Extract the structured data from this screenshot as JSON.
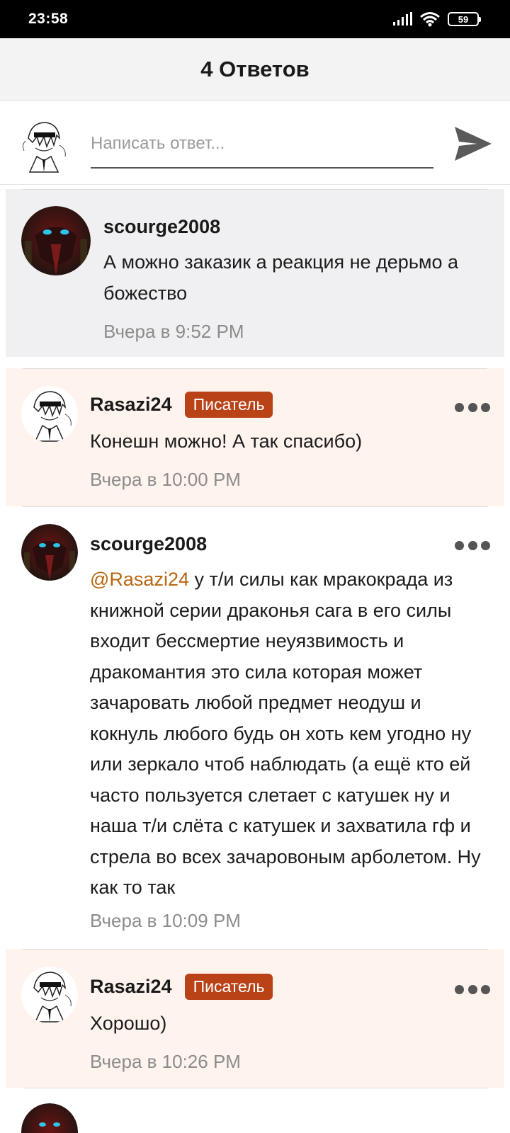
{
  "status_bar": {
    "time": "23:58",
    "battery": "59"
  },
  "header": {
    "title": "4 Ответов"
  },
  "composer": {
    "placeholder": "Написать ответ..."
  },
  "comments": [
    {
      "username": "scourge2008",
      "text": "А можно заказик а реакция не дерьмо а божество",
      "timestamp": "Вчера в 9:52 PM"
    },
    {
      "username": "Rasazi24",
      "badge": "Писатель",
      "text": "Конешн можно! А так спасибо)",
      "timestamp": "Вчера в 10:00 PM"
    },
    {
      "username": "scourge2008",
      "mention": "@Rasazi24",
      "text": " у т/и силы как мракокрада из книжной серии драконья сага в его силы входит бессмертие неуязвимость и дракомантия это сила которая может зачаровать любой предмет неодуш и кокнуль любого будь он хоть кем угодно ну или зеркало чтоб наблюдать (а ещё кто ей часто пользуется слетает с катушек ну и наша т/и слёта с катушек и захватила гф и стрела во всех зачаровоным арболетом. Ну как то так",
      "timestamp": "Вчера в 10:09 PM"
    },
    {
      "username": "Rasazi24",
      "badge": "Писатель",
      "text": "Хорошо)",
      "timestamp": "Вчера в 10:26 PM"
    }
  ],
  "colors": {
    "badge": "#b94317",
    "mention": "#b8660f",
    "author_bg": "#fff3ee",
    "highlight_bg": "#f0f0f2"
  },
  "icons": [
    "signal-icon",
    "wifi-icon",
    "battery-icon",
    "send-icon",
    "more-icon"
  ]
}
